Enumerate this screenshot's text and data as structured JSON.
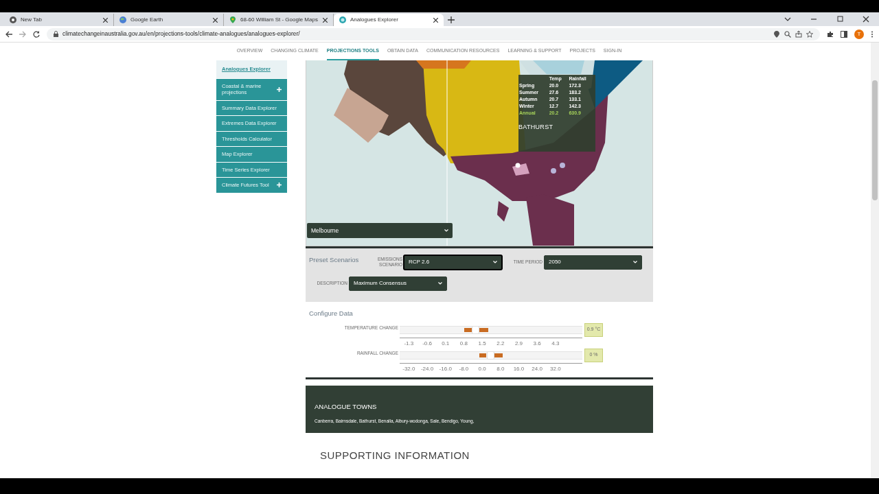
{
  "browser": {
    "tabs": [
      {
        "title": "New Tab",
        "selected": false
      },
      {
        "title": "Google Earth",
        "selected": false
      },
      {
        "title": "68-60 William St - Google Maps",
        "selected": false
      },
      {
        "title": "Analogues Explorer",
        "selected": true
      }
    ],
    "url": "climatechangeinaustralia.gov.au/en/projections-tools/climate-analogues/analogues-explorer/",
    "profile": "T"
  },
  "nav": [
    {
      "label": "OVERVIEW",
      "selected": false
    },
    {
      "label": "CHANGING CLIMATE",
      "selected": false
    },
    {
      "label": "PROJECTIONS TOOLS",
      "selected": true
    },
    {
      "label": "OBTAIN DATA",
      "selected": false
    },
    {
      "label": "COMMUNICATION RESOURCES",
      "selected": false
    },
    {
      "label": "LEARNING & SUPPORT",
      "selected": false
    },
    {
      "label": "PROJECTS",
      "selected": false
    },
    {
      "label": "SIGN-IN",
      "selected": false
    }
  ],
  "sidebar": {
    "items": [
      {
        "label": "Analogues Explorer",
        "selected": true,
        "expandable": false
      },
      {
        "label": "Coastal & marine projections",
        "selected": false,
        "expandable": true
      },
      {
        "label": "Summary Data Explorer",
        "selected": false,
        "expandable": false
      },
      {
        "label": "Extremes Data Explorer",
        "selected": false,
        "expandable": false
      },
      {
        "label": "Thresholds Calculator",
        "selected": false,
        "expandable": false
      },
      {
        "label": "Map Explorer",
        "selected": false,
        "expandable": false
      },
      {
        "label": "Time Series Explorer",
        "selected": false,
        "expandable": false
      },
      {
        "label": "Climate Futures Tool",
        "selected": false,
        "expandable": true
      }
    ]
  },
  "map": {
    "kind": "picture",
    "location_select": "Melbourne",
    "tooltip": {
      "columns": [
        "Temp",
        "Rainfall"
      ],
      "rows": [
        {
          "season": "Spring",
          "temp": "20.0",
          "rainfall": "172.3",
          "highlight": false
        },
        {
          "season": "Summer",
          "temp": "27.6",
          "rainfall": "183.2",
          "highlight": false
        },
        {
          "season": "Autumn",
          "temp": "20.7",
          "rainfall": "133.1",
          "highlight": false
        },
        {
          "season": "Winter",
          "temp": "12.7",
          "rainfall": "142.3",
          "highlight": false
        },
        {
          "season": "Annual",
          "temp": "20.2",
          "rainfall": "630.9",
          "highlight": true
        }
      ],
      "town": "BATHURST"
    }
  },
  "preset": {
    "title": "Preset Scenarios",
    "fields": [
      {
        "label": "EMISSIONS SCENARIO",
        "value": "RCP 2.6",
        "focused": true
      },
      {
        "label": "TIME PERIOD",
        "value": "2050",
        "focused": false
      },
      {
        "label": "DESCRIPTION",
        "value": "Maximum Consensus",
        "focused": false
      }
    ]
  },
  "configure": {
    "title": "Configure Data",
    "sliders": [
      {
        "label": "TEMPERATURE CHANGE",
        "level": 0.415,
        "reading": "0.9 °C",
        "ticks": [
          "-1.3",
          "-0.6",
          "0.1",
          "0.8",
          "1.5",
          "2.2",
          "2.9",
          "3.6",
          "4.3"
        ]
      },
      {
        "label": "RAINFALL CHANGE",
        "level": 0.495,
        "reading": "0 %",
        "ticks": [
          "-32.0",
          "-24.0",
          "-16.0",
          "-8.0",
          "0.0",
          "8.0",
          "16.0",
          "24.0",
          "32.0"
        ]
      }
    ]
  },
  "analogue_towns": {
    "title": "ANALOGUE TOWNS",
    "towns": "Canberra, Bairnsdale, Bathurst, Benalla, Albury-wodonga, Sale, Bendigo, Young,"
  },
  "supporting": {
    "title": "SUPPORTING INFORMATION"
  }
}
